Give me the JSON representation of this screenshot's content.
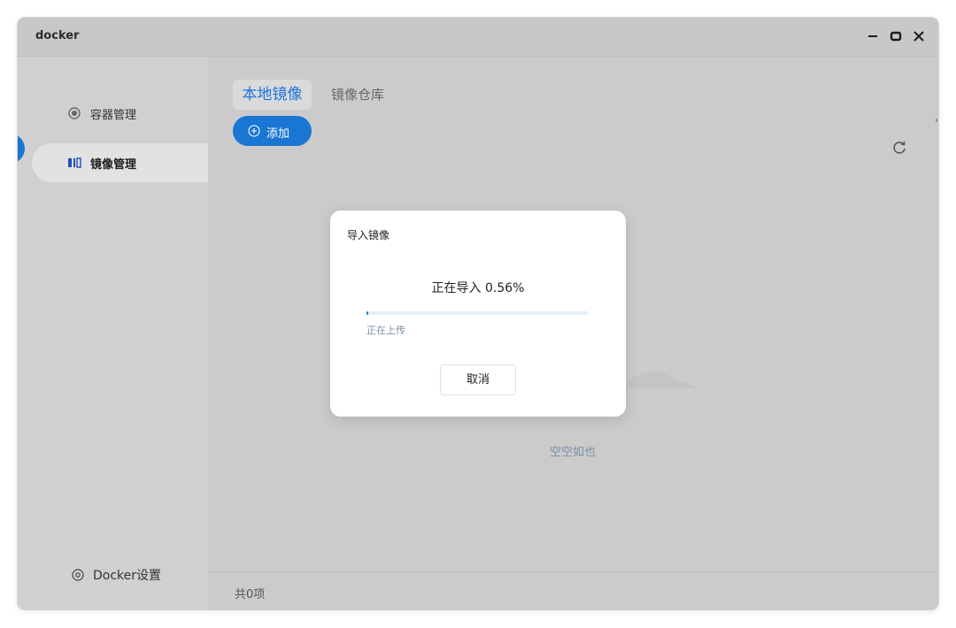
{
  "window": {
    "title": "docker"
  },
  "sidebar": {
    "items": [
      {
        "label": "容器管理",
        "icon": "container-icon",
        "active": false
      },
      {
        "label": "镜像管理",
        "icon": "image-icon",
        "active": true
      }
    ],
    "settings_label": "Docker设置"
  },
  "main": {
    "tabs": [
      {
        "label": "本地镜像",
        "active": true
      },
      {
        "label": "镜像仓库",
        "active": false
      }
    ],
    "add_label": "添加",
    "empty_text": "空空如也",
    "footer_count": "共0项"
  },
  "dialog": {
    "title": "导入镜像",
    "progress_text": "正在导入 0.56%",
    "progress_percent": 0.56,
    "status_text": "正在上传",
    "cancel_label": "取消"
  },
  "colors": {
    "accent": "#1976d2",
    "tab_active_text": "#1a73d9"
  }
}
